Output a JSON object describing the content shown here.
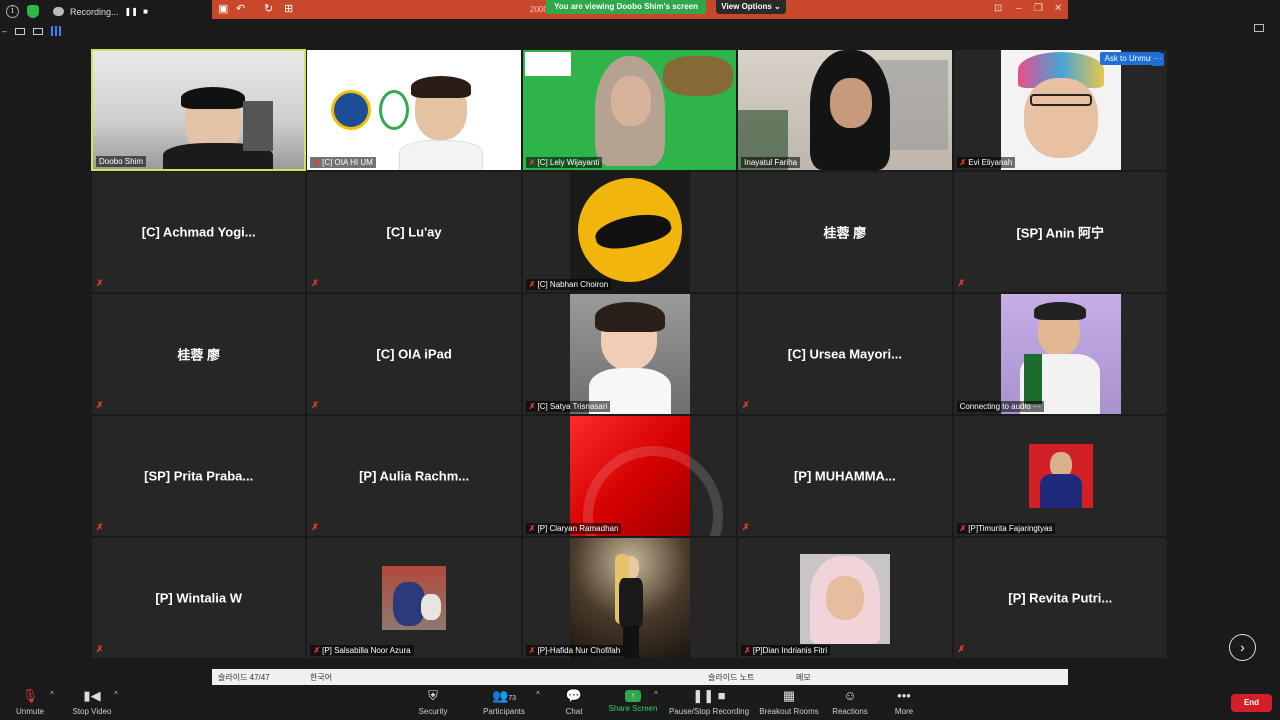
{
  "recording": {
    "label": "Recording..."
  },
  "ppt": {
    "title": "2000",
    "viewing": "You are viewing Doobo Shim's screen",
    "view_options": "View Options"
  },
  "ask_unmute": "Ask to Unmute",
  "tiles": [
    {
      "label": "Doobo Shim",
      "has_video": true,
      "muted": false,
      "active": true
    },
    {
      "label": "[C] OIA HI UM",
      "has_video": true,
      "muted": true
    },
    {
      "label": "[C] Lely Wijayanti",
      "has_video": true,
      "muted": true
    },
    {
      "label": "Inayatul Fariha",
      "has_video": true,
      "muted": false
    },
    {
      "label": "Evi Eliyanah",
      "has_video": true,
      "muted": true
    },
    {
      "name": "[C]  Achmad  Yogi...",
      "muted": true
    },
    {
      "name": "[C]  Lu'ay",
      "muted": true
    },
    {
      "label": "[C] Nabhan Choiron",
      "has_video": true,
      "muted": true
    },
    {
      "name": "桂蓉  廖",
      "muted": false
    },
    {
      "name": "[SP]  Anin 阿宁",
      "muted": true
    },
    {
      "name": "桂蓉  廖",
      "muted": true
    },
    {
      "name": "[C] OIA iPad",
      "muted": true
    },
    {
      "label": "[C] Satya Trisnasari",
      "has_video": true,
      "muted": true
    },
    {
      "name": "[C]  Ursea  Mayori...",
      "muted": true
    },
    {
      "label": "Connecting to audio ⋯",
      "has_video": true,
      "muted": false
    },
    {
      "name": "[SP]  Prita  Praba...",
      "muted": true
    },
    {
      "name": "[P]  Aulia  Rachm...",
      "muted": true
    },
    {
      "label": "[P] Claryan Ramadhan",
      "has_video": true,
      "muted": true
    },
    {
      "name": "[P]  MUHAMMA...",
      "muted": true
    },
    {
      "label": "[P]Timurita Fajaringtyas",
      "has_video": true,
      "muted": true
    },
    {
      "name": "[P]  Wintalia  W",
      "muted": true
    },
    {
      "label": "[P] Salsabilla Noor Azura",
      "has_video": true,
      "muted": true
    },
    {
      "label": "[P]-Hafida Nur Chofifah",
      "has_video": true,
      "muted": true
    },
    {
      "label": "[P]Dian Indrianis Fitri",
      "has_video": true,
      "muted": true
    },
    {
      "name": "[P]  Revita  Putri...",
      "muted": true
    }
  ],
  "ppt_status": {
    "slide": "슬라이드 47/47",
    "lang": "한국어",
    "notes": "슬라이드 노트",
    "memo": "메모"
  },
  "toolbar": {
    "unmute": "Unmute",
    "stop_video": "Stop Video",
    "security": "Security",
    "participants": "Participants",
    "participants_count": "73",
    "chat": "Chat",
    "share_screen": "Share Screen",
    "pause_recording": "Pause/Stop Recording",
    "breakout": "Breakout Rooms",
    "reactions": "Reactions",
    "more": "More",
    "end": "End"
  },
  "colors": {
    "accent_green": "#2ea84b",
    "ppt_orange": "#c9482b",
    "end_red": "#d21f2a",
    "active_border": "#d4e157"
  }
}
